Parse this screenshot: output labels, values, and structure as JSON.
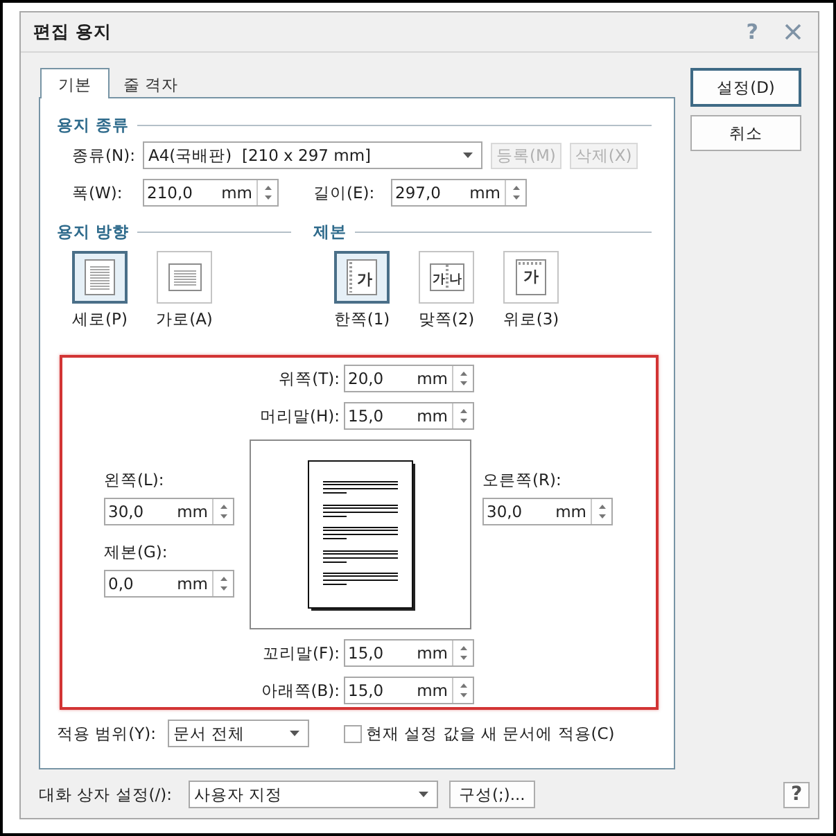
{
  "window": {
    "title": "편집 용지",
    "help": "?"
  },
  "tabs": [
    {
      "label": "기본",
      "selected": true
    },
    {
      "label": "줄 격자",
      "selected": false
    }
  ],
  "paper_type": {
    "heading": "용지 종류",
    "type_label": "종류(N):",
    "type_value": "A4(국배판)  [210 x 297 mm]",
    "register_button": {
      "label": "등록(M)",
      "disabled": true
    },
    "delete_button": {
      "label": "삭제(X)",
      "disabled": true
    },
    "width": {
      "label": "폭(W):",
      "value": "210,0",
      "unit": "mm"
    },
    "length": {
      "label": "길이(E):",
      "value": "297,0",
      "unit": "mm"
    }
  },
  "orientation": {
    "heading": "용지 방향",
    "options": [
      {
        "kind": "portrait",
        "label": "세로(P)",
        "selected": true
      },
      {
        "kind": "landscape",
        "label": "가로(A)",
        "selected": false
      }
    ]
  },
  "binding": {
    "heading": "제본",
    "options": [
      {
        "kind": "single",
        "label": "한쪽(1)",
        "icon_text": [
          "가"
        ],
        "selected": true
      },
      {
        "kind": "facing",
        "label": "맞쪽(2)",
        "icon_text": [
          "가",
          "나"
        ],
        "selected": false
      },
      {
        "kind": "top",
        "label": "위로(3)",
        "icon_text": [
          "가"
        ],
        "selected": false
      }
    ]
  },
  "margins": {
    "highlighted": true,
    "top": {
      "label": "위쪽(T):",
      "value": "20,0",
      "unit": "mm"
    },
    "header": {
      "label": "머리말(H):",
      "value": "15,0",
      "unit": "mm"
    },
    "left": {
      "label": "왼쪽(L):",
      "value": "30,0",
      "unit": "mm"
    },
    "gutter": {
      "label": "제본(G):",
      "value": "0,0",
      "unit": "mm"
    },
    "right": {
      "label": "오른쪽(R):",
      "value": "30,0",
      "unit": "mm"
    },
    "footer": {
      "label": "꼬리말(F):",
      "value": "15,0",
      "unit": "mm"
    },
    "bottom": {
      "label": "아래쪽(B):",
      "value": "15,0",
      "unit": "mm"
    }
  },
  "apply": {
    "label": "적용 범위(Y):",
    "value": "문서 전체",
    "checkbox": {
      "label": "현재 설정 값을 새 문서에 적용(C)",
      "checked": false
    }
  },
  "buttons": [
    {
      "label": "설정(D)",
      "default": true
    },
    {
      "label": "취소",
      "default": false
    }
  ],
  "dialog_settings": {
    "label": "대화 상자 설정(/):",
    "value": "사용자 지정",
    "button": "구성(;)...",
    "help": "?"
  }
}
